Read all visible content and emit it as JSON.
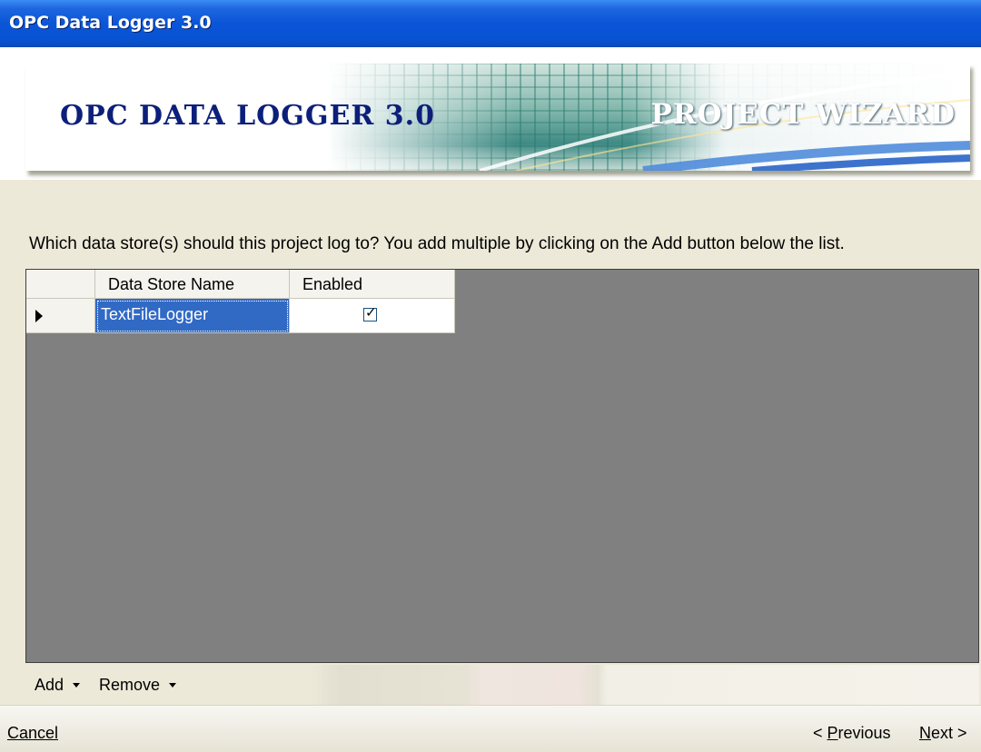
{
  "window": {
    "title": "OPC Data Logger 3.0"
  },
  "banner": {
    "brand": "OPC DATA LOGGER 3.0",
    "wizard": "PROJECT WIZARD"
  },
  "instruction": "Which data store(s) should this project log to? You add multiple by clicking on the Add button below the list.",
  "grid": {
    "columns": [
      "Data Store Name",
      "Enabled"
    ],
    "rows": [
      {
        "name": "TextFileLogger",
        "enabled": true,
        "selected": true
      }
    ]
  },
  "toolstrip": {
    "add_label": "Add",
    "remove_label": "Remove"
  },
  "footer": {
    "cancel_label": "Cancel",
    "previous_prefix": "< ",
    "previous_mnemonic": "P",
    "previous_rest": "revious",
    "next_mnemonic": "N",
    "next_rest": "ext >"
  },
  "colors": {
    "title_bar": "#0A55D8",
    "selection": "#316AC5",
    "grid_background": "#808080",
    "dialog_background": "#ECE9D8",
    "brand_text": "#0C1F7A"
  },
  "icons": {
    "row_indicator": "row-indicator-arrow-icon",
    "dropdown": "chevron-down-icon",
    "check": "checkmark-icon"
  }
}
